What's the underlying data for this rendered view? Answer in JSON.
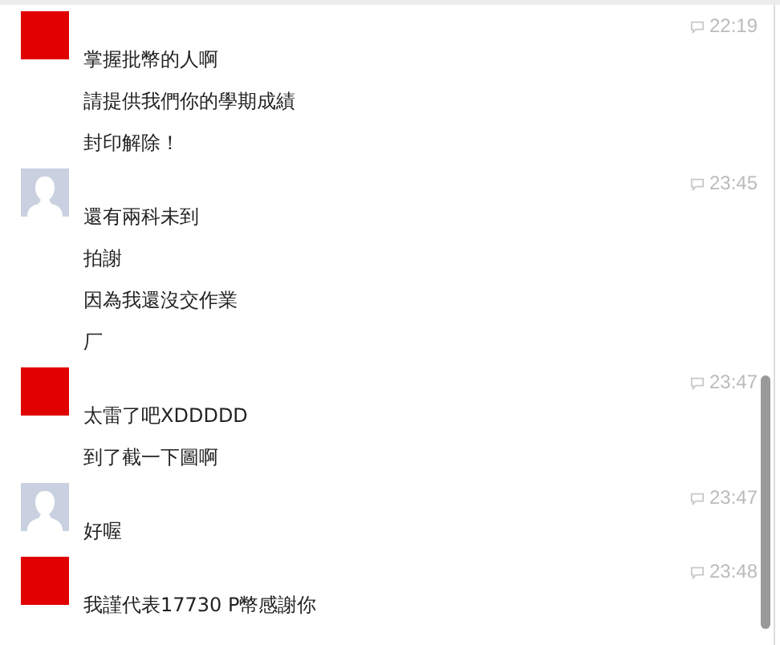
{
  "messages": [
    {
      "avatar": {
        "kind": "square"
      },
      "time": "22:19",
      "lines": [
        "掌握批幣的人啊",
        "請提供我們你的學期成績",
        "封印解除！"
      ]
    },
    {
      "avatar": {
        "kind": "silhouette"
      },
      "time": "23:45",
      "lines": [
        "還有兩科未到",
        "拍謝",
        "因為我還沒交作業",
        "厂"
      ]
    },
    {
      "avatar": {
        "kind": "square"
      },
      "time": "23:47",
      "lines": [
        "太雷了吧XDDDDD",
        "到了截一下圖啊"
      ]
    },
    {
      "avatar": {
        "kind": "silhouette"
      },
      "time": "23:47",
      "lines": [
        "好喔"
      ]
    },
    {
      "avatar": {
        "kind": "square"
      },
      "time": "23:48",
      "lines": [
        "我謹代表17730 P幣感謝你"
      ]
    }
  ]
}
